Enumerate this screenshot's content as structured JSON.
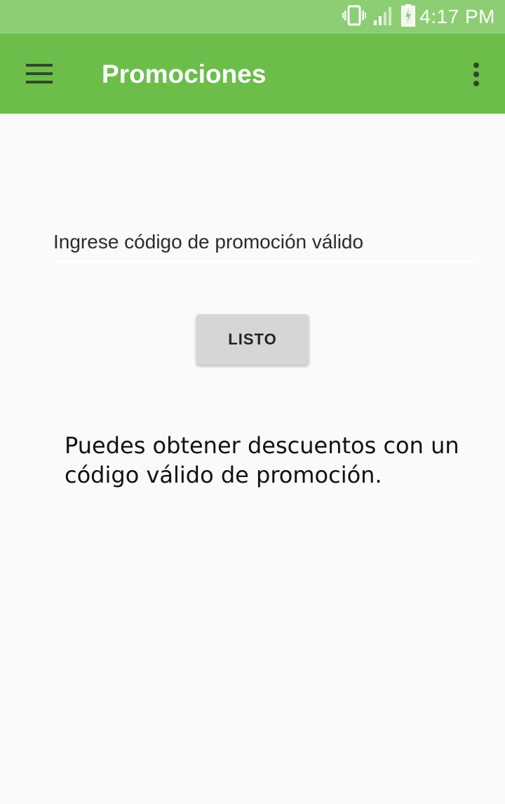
{
  "status_bar": {
    "time": "4:17 PM",
    "icons": [
      "vibrate-icon",
      "signal-icon",
      "battery-charging-icon"
    ]
  },
  "app_bar": {
    "title": "Promociones",
    "menu_icon": "hamburger-menu-icon",
    "overflow_icon": "more-vert-icon"
  },
  "form": {
    "promo_placeholder": "Ingrese código de promoción válido",
    "submit_label": "LISTO"
  },
  "info": {
    "text": "Puedes obtener descuentos con un código válido de promoción."
  },
  "colors": {
    "status_bar": "#8dce75",
    "app_bar": "#6cbd4a",
    "background": "#fafafa",
    "button": "#d6d6d6"
  }
}
